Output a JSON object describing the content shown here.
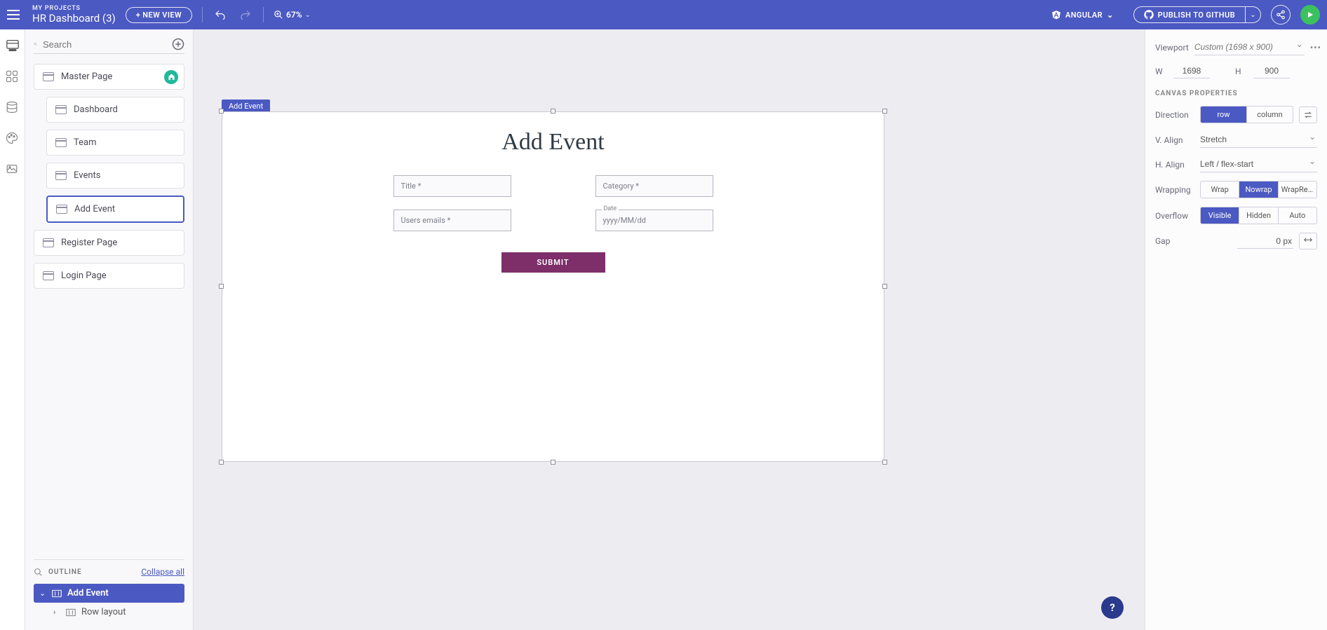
{
  "header": {
    "my_projects": "MY PROJECTS",
    "project_title": "HR Dashboard (3)",
    "new_view": "+ NEW VIEW",
    "zoom": "67%",
    "framework": "ANGULAR",
    "publish": "PUBLISH TO GITHUB"
  },
  "left": {
    "search_placeholder": "Search",
    "pages": {
      "master": "Master Page",
      "dashboard": "Dashboard",
      "team": "Team",
      "events": "Events",
      "add_event": "Add Event",
      "register": "Register Page",
      "login": "Login Page"
    },
    "outline": {
      "title": "OUTLINE",
      "collapse": "Collapse all",
      "root": "Add Event",
      "child": "Row layout"
    }
  },
  "canvas": {
    "sel_label": "Add Event",
    "heading": "Add Event",
    "title_label": "Title *",
    "category_label": "Category *",
    "users_label": "Users emails *",
    "date_float": "Date",
    "date_placeholder": "yyyy/MM/dd",
    "submit": "SUBMIT"
  },
  "props": {
    "viewport_lbl": "Viewport",
    "viewport_val": "Custom (1698 x 900)",
    "w_lbl": "W",
    "w_val": "1698",
    "h_lbl": "H",
    "h_val": "900",
    "section": "CANVAS PROPERTIES",
    "direction_lbl": "Direction",
    "row": "row",
    "column": "column",
    "valign_lbl": "V. Align",
    "valign_val": "Stretch",
    "halign_lbl": "H. Align",
    "halign_val": "Left / flex-start",
    "wrapping_lbl": "Wrapping",
    "wrap": "Wrap",
    "nowrap": "Nowrap",
    "wraprev": "WrapRe...",
    "overflow_lbl": "Overflow",
    "visible": "Visible",
    "hidden": "Hidden",
    "auto": "Auto",
    "gap_lbl": "Gap",
    "gap_val": "0 px"
  }
}
